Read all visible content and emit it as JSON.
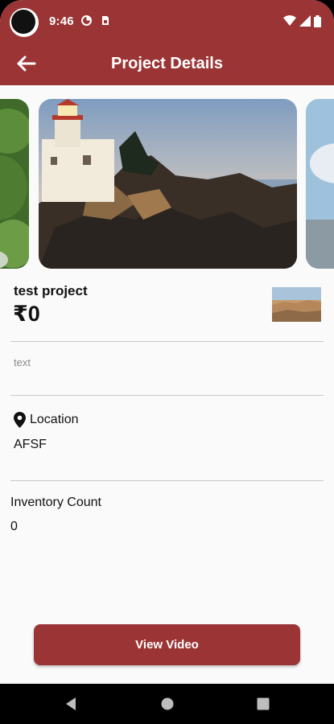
{
  "status_bar": {
    "time": "9:46",
    "icons": [
      "data-saver-icon",
      "sim-card-icon",
      "wifi-icon",
      "signal-icon",
      "battery-icon"
    ]
  },
  "app_bar": {
    "title": "Project Details",
    "back_icon": "back-arrow-icon",
    "color": "#9b3535"
  },
  "carousel": {
    "slides": [
      "leaves",
      "lighthouse",
      "beach"
    ]
  },
  "project": {
    "name": "test project",
    "price": "₹0",
    "description": "text"
  },
  "location": {
    "label": "Location",
    "value": "AFSF",
    "icon": "location-pin-icon"
  },
  "inventory": {
    "label": "Inventory Count",
    "value": "0"
  },
  "actions": {
    "view_video": "View Video"
  },
  "nav_bar": {
    "buttons": [
      "back-triangle-icon",
      "home-circle-icon",
      "recents-square-icon"
    ]
  }
}
